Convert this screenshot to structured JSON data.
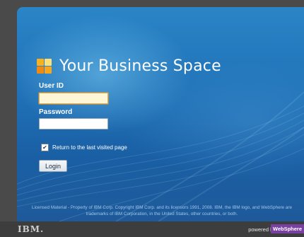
{
  "app": {
    "title": "Your Business Space"
  },
  "form": {
    "user_id_label": "User ID",
    "user_id_value": "",
    "password_label": "Password",
    "password_value": "",
    "remember_label": "Return to the last visited page",
    "remember_checked": true,
    "login_label": "Login"
  },
  "legal": {
    "text": "Licensed Material - Property of IBM Corp. Copyright IBM Corp. and its licensors 1991, 2008. IBM, the IBM logo, and WebSphere are trademarks of IBM Corporation, in the United States, other countries, or both."
  },
  "footer": {
    "ibm_logo": "IBM.",
    "powered_by": "powered by",
    "websphere": "WebSphere"
  }
}
